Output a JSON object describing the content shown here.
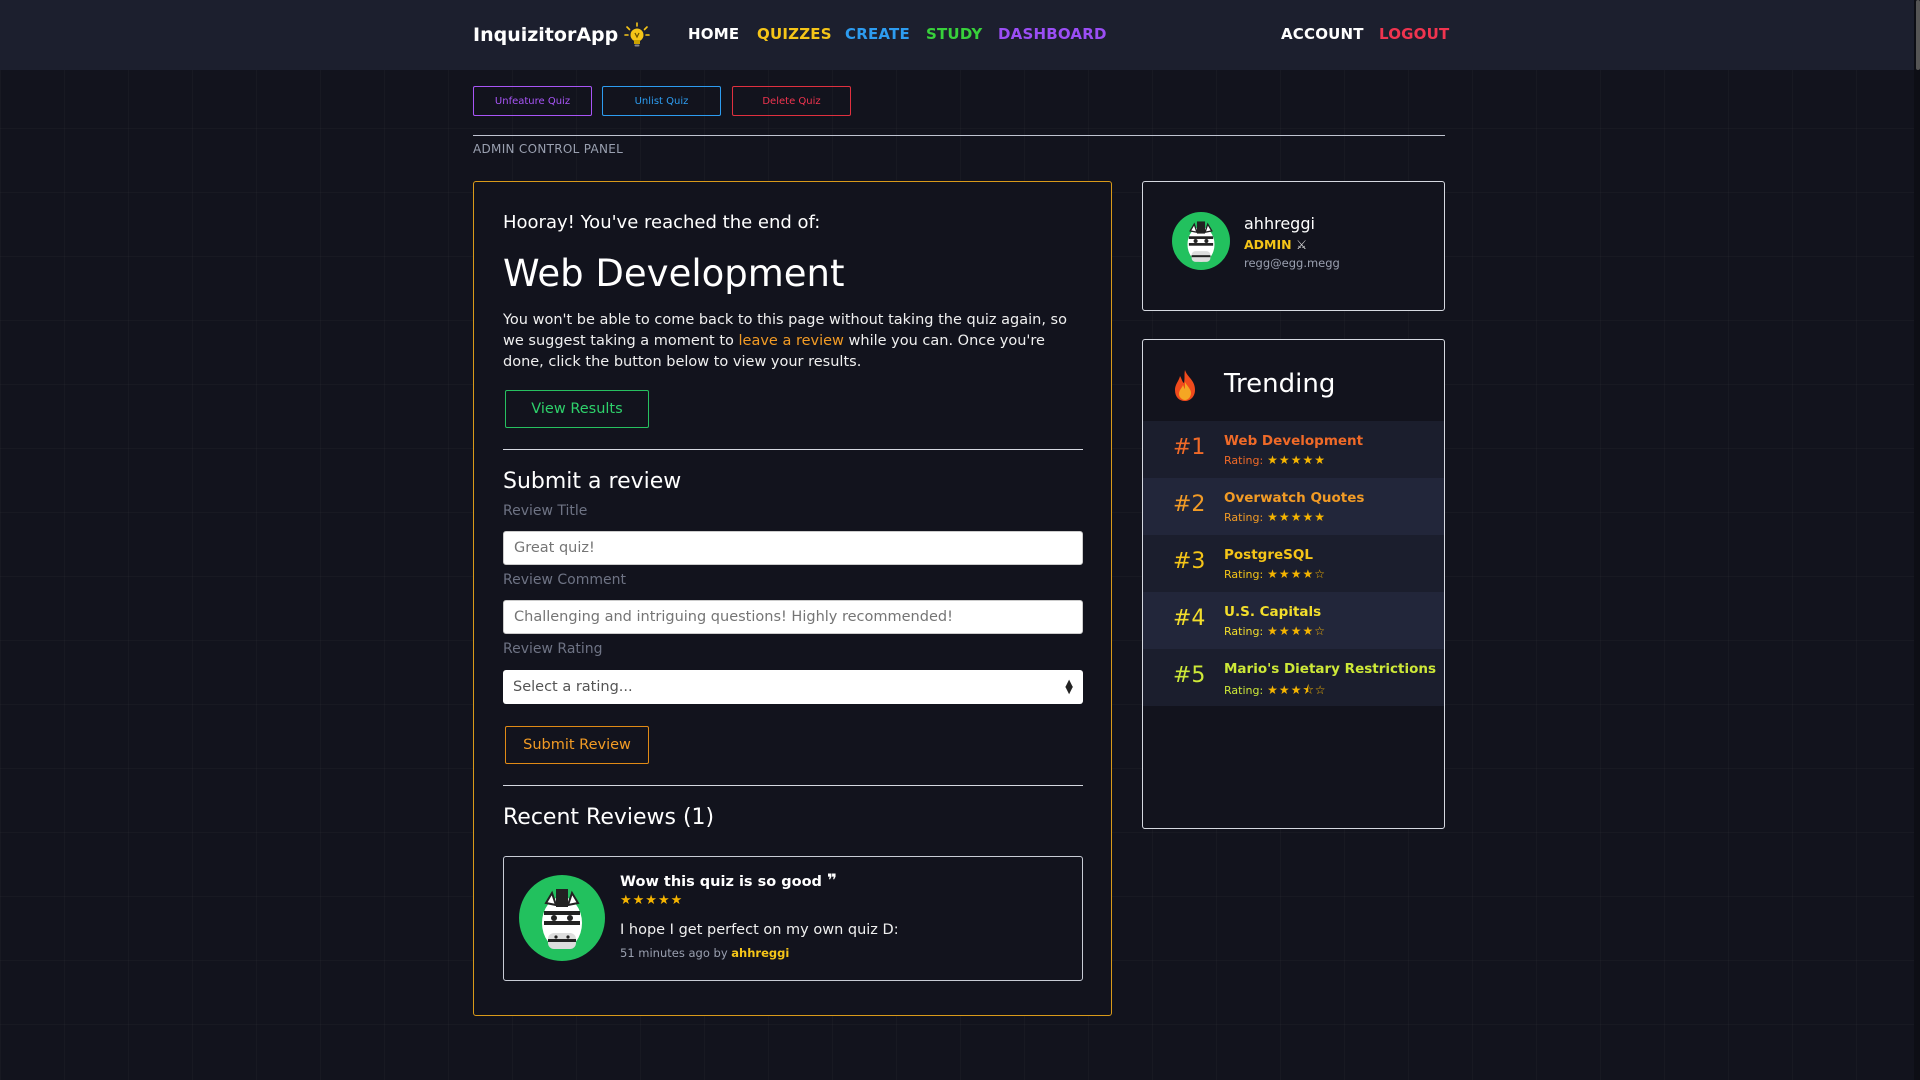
{
  "nav": {
    "brand": "InquizitorApp",
    "home": "HOME",
    "quizzes": "QUIZZES",
    "create": "CREATE",
    "study": "STUDY",
    "dashboard": "DASHBOARD",
    "account": "ACCOUNT",
    "logout": "LOGOUT"
  },
  "admin": {
    "unfeature": "Unfeature Quiz",
    "unlist": "Unlist Quiz",
    "delete": "Delete Quiz",
    "panel_label": "ADMIN CONTROL PANEL"
  },
  "end": {
    "hooray": "Hooray! You've reached the end of:",
    "quiz_title": "Web Development",
    "text_before": "You won't be able to come back to this page without taking the quiz again, so we suggest taking a moment to ",
    "link": "leave a review",
    "text_after": " while you can. Once you're done, click the button below to view your results.",
    "view_results": "View Results"
  },
  "review_form": {
    "heading": "Submit a review",
    "title_label": "Review Title",
    "title_placeholder": "Great quiz!",
    "comment_label": "Review Comment",
    "comment_placeholder": "Challenging and intriguing questions! Highly recommended!",
    "rating_label": "Review Rating",
    "rating_selected": "Select a rating...",
    "submit": "Submit Review"
  },
  "recent": {
    "heading": "Recent Reviews (1)",
    "reviews": [
      {
        "title": "Wow this quiz is so good",
        "rating": 5,
        "stars": "★★★★★",
        "comment": "I hope I get perfect on my own quiz D:",
        "time": "51 minutes ago by",
        "author": "ahhreggi"
      }
    ]
  },
  "profile": {
    "username": "ahhreggi",
    "role": "ADMIN",
    "email": "regg@egg.megg"
  },
  "trending": {
    "heading": "Trending",
    "rating_label": "Rating:",
    "items": [
      {
        "rank": "#1",
        "name": "Web Development",
        "rating": 5,
        "stars": "★★★★★",
        "color": "#f06a28"
      },
      {
        "rank": "#2",
        "name": "Overwatch Quotes",
        "rating": 5,
        "stars": "★★★★★",
        "color": "#f29b25"
      },
      {
        "rank": "#3",
        "name": "PostgreSQL",
        "rating": 4,
        "stars": "★★★★☆",
        "color": "#f5c518"
      },
      {
        "rank": "#4",
        "name": "U.S. Capitals",
        "rating": 4,
        "stars": "★★★★☆",
        "color": "#f3de2c"
      },
      {
        "rank": "#5",
        "name": "Mario's Dietary Restrictions",
        "rating": 3.5,
        "stars": "★★★⯪☆",
        "color": "#cde838"
      }
    ]
  },
  "colors": {
    "accent_orange": "#f29b25",
    "quizzes": "#f5c518",
    "create": "#2d9cf0",
    "study": "#38d13b",
    "dashboard": "#9b4ef5",
    "logout": "#f0344f",
    "admin_role": "#f5c518"
  }
}
